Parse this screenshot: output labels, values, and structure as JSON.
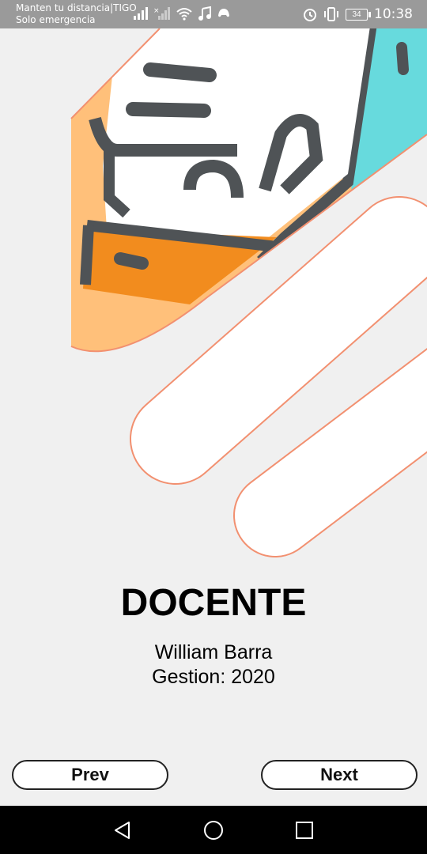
{
  "status_bar": {
    "carrier_line1": "Manten tu distancia|TIGO",
    "carrier_line2": "Solo emergencia",
    "battery": "34",
    "time": "10:38"
  },
  "content": {
    "title": "DOCENTE",
    "name": "William Barra",
    "gestion": "Gestion: 2020"
  },
  "buttons": {
    "prev": "Prev",
    "next": "Next"
  },
  "colors": {
    "orange": "#f28c1e",
    "light_orange": "#ffc07a",
    "teal": "#67dadd",
    "dark": "#4f5356"
  }
}
